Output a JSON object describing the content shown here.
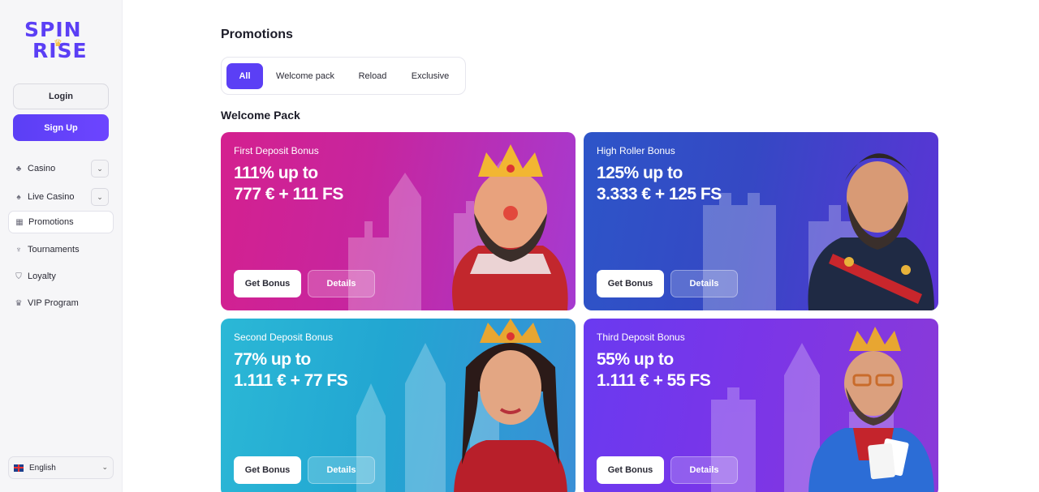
{
  "brand": {
    "line1": "SPIN",
    "line2": "RISE"
  },
  "auth": {
    "login_label": "Login",
    "signup_label": "Sign Up"
  },
  "sidebar": {
    "items": [
      {
        "label": "Casino",
        "icon": "casino-icon",
        "has_chevron": true
      },
      {
        "label": "Live Casino",
        "icon": "live-casino-icon",
        "has_chevron": true
      },
      {
        "label": "Promotions",
        "icon": "gift-icon",
        "active": true
      },
      {
        "label": "Tournaments",
        "icon": "trophy-icon"
      },
      {
        "label": "Loyalty",
        "icon": "shield-icon"
      },
      {
        "label": "VIP Program",
        "icon": "crown-icon"
      }
    ],
    "language": "English"
  },
  "main": {
    "title": "Promotions",
    "tabs": [
      {
        "label": "All",
        "active": true
      },
      {
        "label": "Welcome pack"
      },
      {
        "label": "Reload"
      },
      {
        "label": "Exclusive"
      }
    ],
    "section_title": "Welcome Pack",
    "cards": [
      {
        "subtitle": "First Deposit Bonus",
        "line1": "111% up to",
        "line2": "777 € + 111 FS",
        "get_label": "Get Bonus",
        "details_label": "Details"
      },
      {
        "subtitle": "High Roller Bonus",
        "line1": "125% up to",
        "line2": "3.333 € + 125 FS",
        "get_label": "Get Bonus",
        "details_label": "Details"
      },
      {
        "subtitle": "Second Deposit Bonus",
        "line1": "77% up to",
        "line2": "1.111 € + 77 FS",
        "get_label": "Get Bonus",
        "details_label": "Details"
      },
      {
        "subtitle": "Third Deposit Bonus",
        "line1": "55% up to",
        "line2": "1.111 € + 55 FS",
        "get_label": "Get Bonus",
        "details_label": "Details"
      }
    ]
  },
  "colors": {
    "accent": "#5b3ff5"
  }
}
